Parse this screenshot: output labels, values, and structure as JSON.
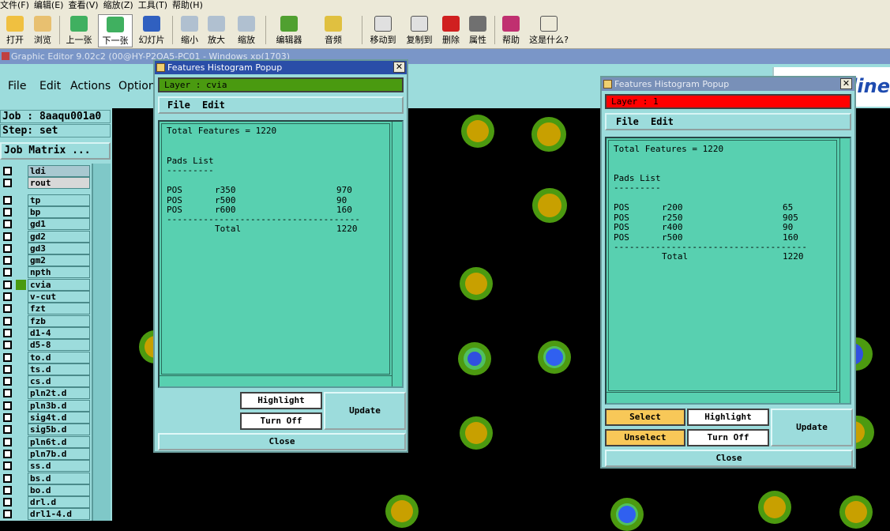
{
  "system_menu": [
    "文件(F)",
    "编辑(E)",
    "查看(V)",
    "缩放(Z)",
    "工具(T)",
    "帮助(H)"
  ],
  "toolbar": {
    "open": "打开",
    "browse": "浏览",
    "prev": "上一张",
    "next": "下一张",
    "slideshow": "幻灯片",
    "zoom_out": "缩小",
    "zoom_in": "放大",
    "zoom": "缩放",
    "editor": "编辑器",
    "audio": "音频",
    "move_to": "移动到",
    "copy_to": "复制到",
    "delete": "删除",
    "properties": "属性",
    "help": "帮助",
    "whats_this": "这是什么?"
  },
  "app": {
    "title": "Graphic Editor 9.02c2 (00@HY-P2QA5-PC01 - Windows xp(1703)",
    "menu": [
      "File",
      "Edit",
      "Actions",
      "Options"
    ],
    "logo": "line"
  },
  "sidebar": {
    "job": "Job : 8aaqu001a0",
    "step": "Step: set",
    "job_matrix": "Job Matrix ...",
    "layers": [
      "ldi",
      "rout",
      "tp",
      "bp",
      "gd1",
      "gd2",
      "gd3",
      "gm2",
      "npth",
      "cvia",
      "v-cut",
      "fzt",
      "fzb",
      "d1-4",
      "d5-8",
      "to.d",
      "ts.d",
      "cs.d",
      "pln2t.d",
      "pln3b.d",
      "sig4t.d",
      "sig5b.d",
      "pln6t.d",
      "pln7b.d",
      "ss.d",
      "bs.d",
      "bo.d",
      "drl.d",
      "drl1-4.d"
    ]
  },
  "popup1": {
    "title": "Features Histogram Popup",
    "layer": "Layer :  cvia",
    "layer_color": "#4a9a10",
    "menu": [
      "File",
      "Edit"
    ],
    "total": "Total Features = 1220",
    "pads_heading": "Pads List",
    "underline": "---------",
    "rows": [
      {
        "type": "POS",
        "sym": "r350",
        "count": "970"
      },
      {
        "type": "POS",
        "sym": "r500",
        "count": "90"
      },
      {
        "type": "POS",
        "sym": "r600",
        "count": "160"
      }
    ],
    "divider": "-------------------------------------",
    "total_label": "Total",
    "total_count": "1220",
    "highlight": "Highlight",
    "turn_off": "Turn Off",
    "update": "Update",
    "close": "Close"
  },
  "popup2": {
    "title": "Features Histogram Popup",
    "layer": "Layer :  1",
    "layer_color": "#ff0000",
    "menu": [
      "File",
      "Edit"
    ],
    "total": "Total Features = 1220",
    "pads_heading": "Pads List",
    "underline": "---------",
    "rows": [
      {
        "type": "POS",
        "sym": "r200",
        "count": "65"
      },
      {
        "type": "POS",
        "sym": "r250",
        "count": "905"
      },
      {
        "type": "POS",
        "sym": "r400",
        "count": "90"
      },
      {
        "type": "POS",
        "sym": "r500",
        "count": "160"
      }
    ],
    "divider": "-------------------------------------",
    "total_label": "Total",
    "total_count": "1220",
    "select": "Select",
    "unselect": "Unselect",
    "highlight": "Highlight",
    "turn_off": "Turn Off",
    "update": "Update",
    "close": "Close"
  }
}
